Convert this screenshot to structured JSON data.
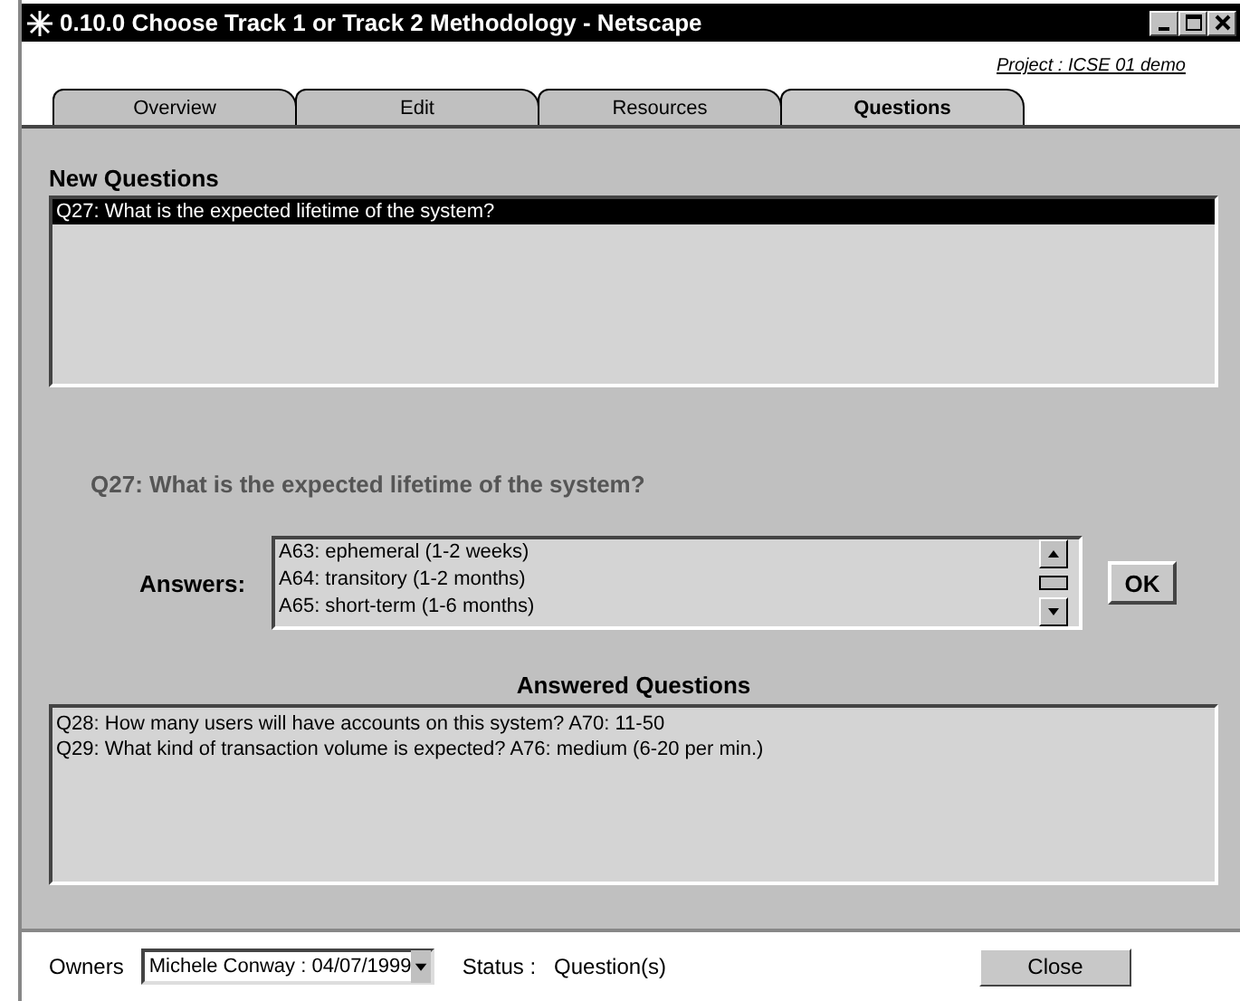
{
  "window": {
    "title": "0.10.0 Choose Track 1 or Track 2 Methodology - Netscape"
  },
  "project_link": "Project : ICSE 01 demo",
  "tabs": [
    {
      "label": "Overview",
      "selected": false
    },
    {
      "label": "Edit",
      "selected": false
    },
    {
      "label": "Resources",
      "selected": false
    },
    {
      "label": "Questions",
      "selected": true
    }
  ],
  "new_questions": {
    "heading": "New Questions",
    "items": [
      {
        "text": "Q27: What is the expected lifetime of the system?",
        "selected": true
      }
    ]
  },
  "current_question": "Q27: What is the expected lifetime of the system?",
  "answers": {
    "label": "Answers:",
    "options": [
      "A63: ephemeral (1-2 weeks)",
      "A64: transitory  (1-2 months)",
      "A65: short-term  (1-6 months)"
    ],
    "ok_button": "OK"
  },
  "answered_questions": {
    "heading": "Answered Questions",
    "items": [
      "Q28: How many users will have accounts on this system? A70: 11-50",
      "Q29: What kind of transaction volume is expected? A76: medium (6-20 per min.)"
    ]
  },
  "footer": {
    "owners_label": "Owners",
    "owner_value": "Michele Conway : 04/07/1999",
    "status_label": "Status :",
    "status_value": "Question(s)",
    "close_button": "Close"
  }
}
